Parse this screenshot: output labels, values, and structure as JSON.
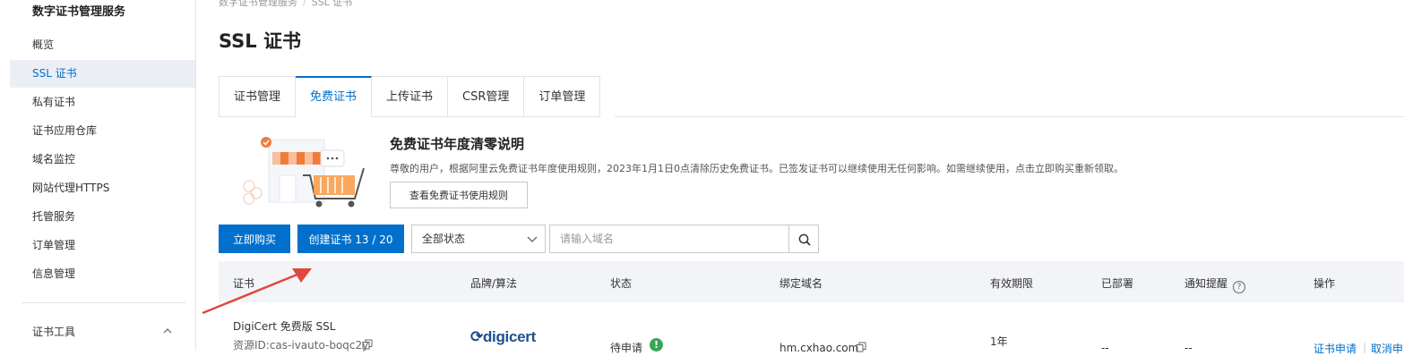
{
  "sidebar": {
    "title": "数字证书管理服务",
    "items": [
      {
        "label": "概览"
      },
      {
        "label": "SSL 证书"
      },
      {
        "label": "私有证书"
      },
      {
        "label": "证书应用仓库"
      },
      {
        "label": "域名监控"
      },
      {
        "label": "网站代理HTTPS"
      },
      {
        "label": "托管服务"
      },
      {
        "label": "订单管理"
      },
      {
        "label": "信息管理"
      }
    ],
    "group": {
      "label": "证书工具",
      "icon": "chevron-up-icon"
    }
  },
  "breadcrumb": {
    "root": "数字证书管理服务",
    "separator": "/",
    "current": "SSL 证书"
  },
  "page_title": "SSL 证书",
  "tabs": [
    {
      "label": "证书管理"
    },
    {
      "label": "免费证书"
    },
    {
      "label": "上传证书"
    },
    {
      "label": "CSR管理"
    },
    {
      "label": "订单管理"
    }
  ],
  "notice": {
    "title": "免费证书年度清零说明",
    "description": "尊敬的用户，根据阿里云免费证书年度使用规则，2023年1月1日0点清除历史免费证书。已签发证书可以继续使用无任何影响。如需继续使用，点击立即购买重新领取。",
    "button_label": "查看免费证书使用规则"
  },
  "toolbar": {
    "buy_label": "立即购买",
    "create_label": "创建证书 13 / 20",
    "status_select": "全部状态",
    "search_placeholder": "请输入域名"
  },
  "table": {
    "headers": {
      "cert": "证书",
      "brand": "品牌/算法",
      "status": "状态",
      "domain": "绑定域名",
      "validity": "有效期限",
      "deployed": "已部署",
      "notify": "通知提醒",
      "actions": "操作"
    },
    "rows": [
      {
        "name": "DigiCert 免费版 SSL",
        "resource_id": "资源ID:cas-ivauto-boqc2y",
        "brand": "digicert",
        "status": "待申请",
        "domain": "hm.cxhao.com",
        "validity": "1年",
        "deployed": "--",
        "notify": "--",
        "action_apply": "证书申请",
        "action_cancel": "取消申"
      }
    ]
  },
  "colors": {
    "accent": "#0070cc",
    "annotation_arrow": "#e0483f",
    "status_ok": "#3aa655"
  }
}
